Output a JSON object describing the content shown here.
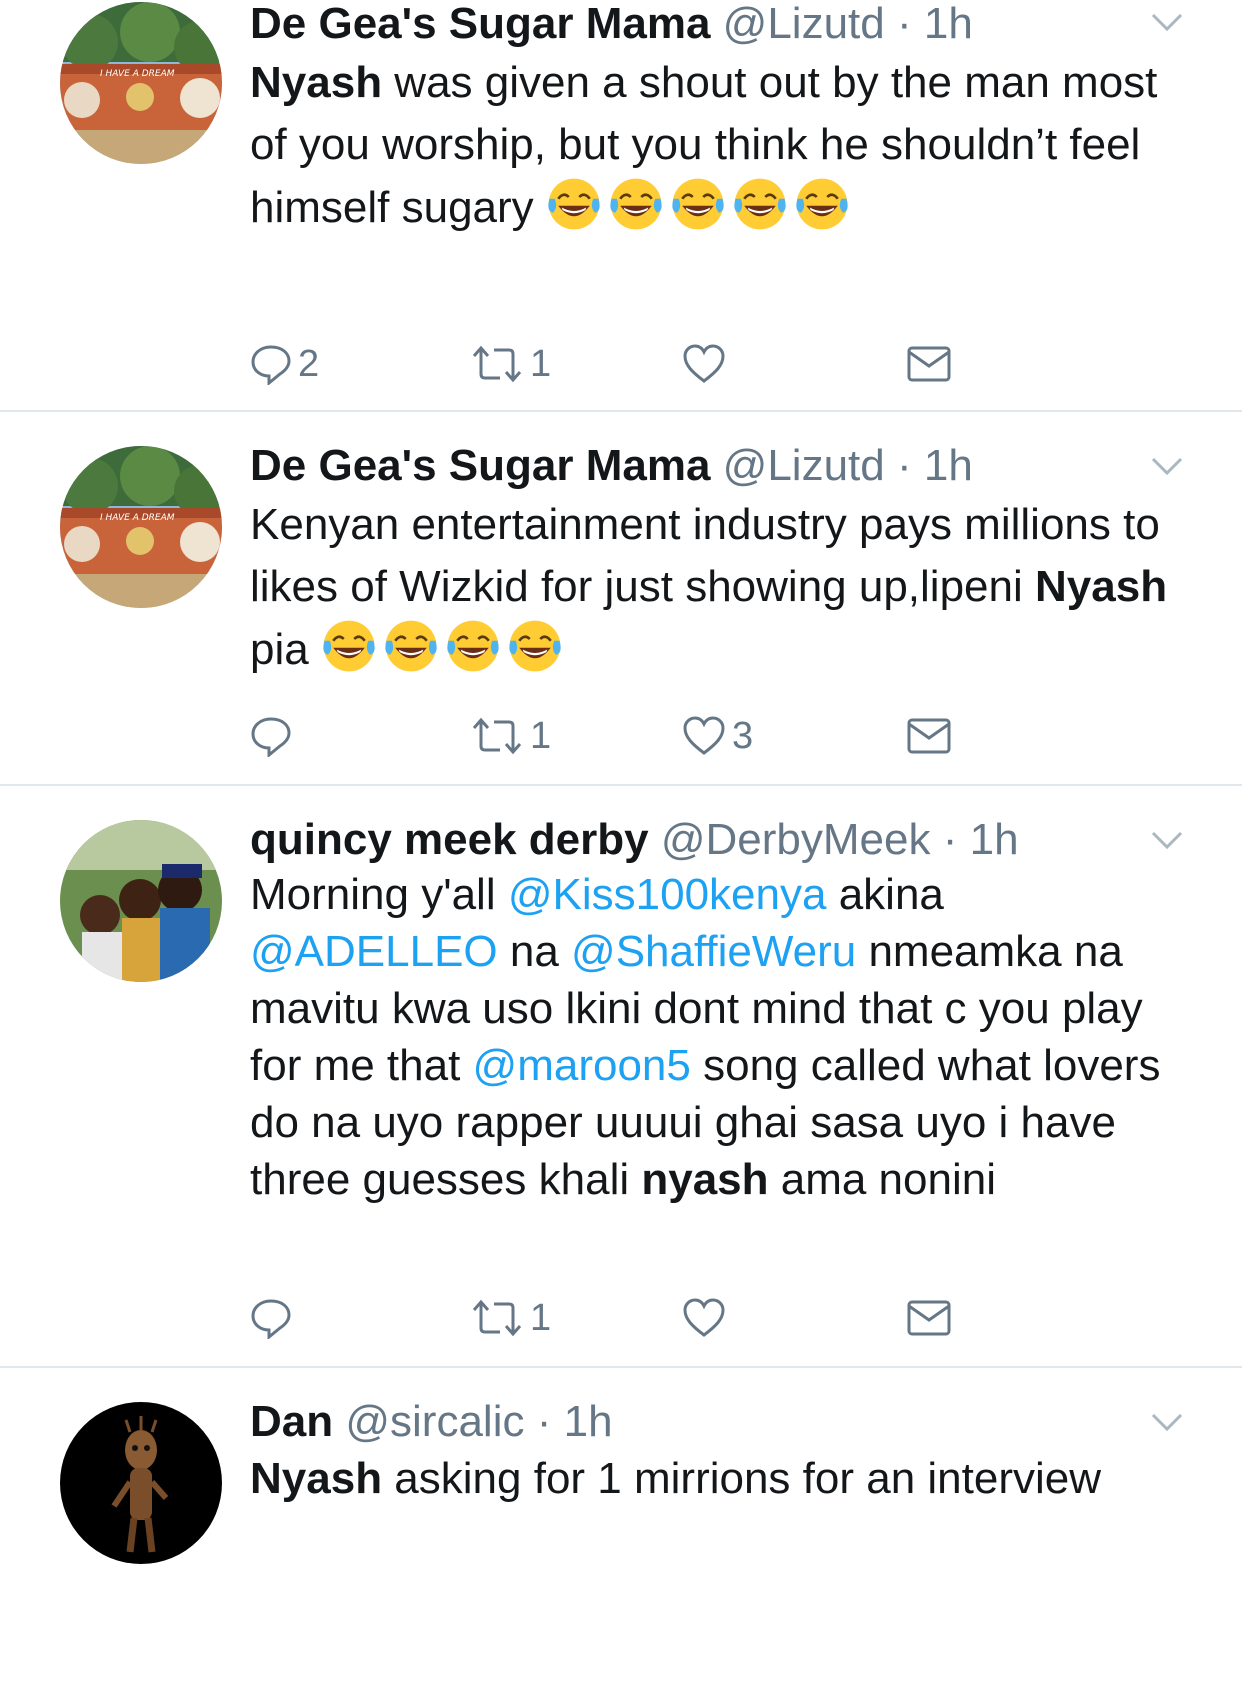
{
  "tweets": [
    {
      "name": "De Gea's Sugar Mama",
      "handle": "@Lizutd",
      "time": "1h",
      "avatar": "mural-wall-avatar",
      "body": [
        {
          "t": "b",
          "v": "Nyash"
        },
        {
          "t": "txt",
          "v": " was given a shout out by the man most of you worship, but you think he shouldn’t feel himself sugary "
        },
        {
          "t": "emoji",
          "n": 5
        }
      ],
      "replies": "2",
      "retweets": "1",
      "likes": ""
    },
    {
      "name": "De Gea's Sugar Mama",
      "handle": "@Lizutd",
      "time": "1h",
      "avatar": "mural-wall-avatar",
      "body": [
        {
          "t": "txt",
          "v": "Kenyan entertainment industry pays millions to likes of Wizkid for just showing up,lipeni "
        },
        {
          "t": "b",
          "v": "Nyash"
        },
        {
          "t": "txt",
          "v": " pia "
        },
        {
          "t": "emoji",
          "n": 4
        }
      ],
      "replies": "",
      "retweets": "1",
      "likes": "3"
    },
    {
      "name": "quincy meek derby",
      "handle": "@DerbyMeek",
      "time": "1h",
      "avatar": "group-selfie-avatar",
      "body": [
        {
          "t": "txt",
          "v": "Morning y'all "
        },
        {
          "t": "m",
          "v": "@Kiss100kenya"
        },
        {
          "t": "txt",
          "v": " akina "
        },
        {
          "t": "m",
          "v": "@ADELLEO"
        },
        {
          "t": "txt",
          "v": " na "
        },
        {
          "t": "m",
          "v": "@ShaffieWeru"
        },
        {
          "t": "txt",
          "v": " nmeamka na mavitu kwa uso lkini dont mind that c you play for me that "
        },
        {
          "t": "m",
          "v": "@maroon5"
        },
        {
          "t": "txt",
          "v": " song called what lovers do na uyo rapper uuuui ghai sasa uyo i have three guesses khali "
        },
        {
          "t": "b",
          "v": "nyash"
        },
        {
          "t": "txt",
          "v": " ama nonini"
        }
      ],
      "replies": "",
      "retweets": "1",
      "likes": ""
    },
    {
      "name": "Dan",
      "handle": "@sircalic",
      "time": "1h",
      "avatar": "groot-avatar",
      "body": [
        {
          "t": "b",
          "v": "Nyash"
        },
        {
          "t": "txt",
          "v": " asking for 1 mirrions for an interview"
        }
      ],
      "replies": "",
      "retweets": "",
      "likes": ""
    }
  ],
  "icons": {
    "reply": "reply-icon",
    "retweet": "retweet-icon",
    "like": "heart-icon",
    "dm": "envelope-icon",
    "more": "chevron-down-icon",
    "emoji": "tears-of-joy-emoji-icon"
  },
  "colors": {
    "text": "#14171a",
    "secondary": "#657786",
    "link": "#1da1f2",
    "divider": "#e1e8ed"
  }
}
